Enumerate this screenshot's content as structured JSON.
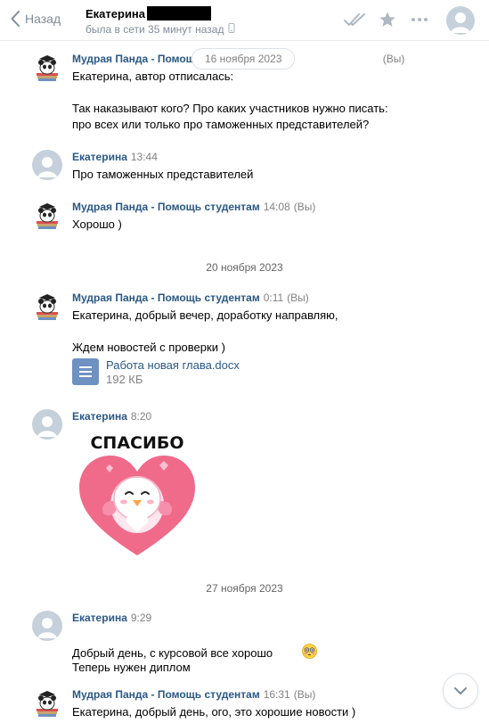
{
  "header": {
    "back_label": "Назад",
    "peer_name": "Екатерина",
    "peer_status": "была в сети 35 минут назад"
  },
  "floating_date": "16 ноября 2023",
  "messages": [
    {
      "author": "Мудрая Панда - Помощь студентам",
      "time": "",
      "suffix": "(Вы)",
      "text": "Екатерина, автор отписалась:\n\nТак наказывают кого? Про каких участников нужно писать:\nпро всех или только про таможенных представителей?"
    },
    {
      "author": "Екатерина",
      "time": "13:44",
      "text": "Про таможенных представителей"
    },
    {
      "author": "Мудрая Панда - Помощь студентам",
      "time": "14:08",
      "suffix": "(Вы)",
      "text": "Хорошо )"
    },
    {
      "author": "Мудрая Панда - Помощь студентам",
      "time": "0:11",
      "suffix": "(Вы)",
      "text": "Екатерина, добрый вечер, доработку направляю,\n\nЖдем новостей с проверки )",
      "file": {
        "name": "Работа новая глава.docx",
        "size": "192 КБ"
      }
    },
    {
      "author": "Екатерина",
      "time": "8:20",
      "sticker": {
        "caption": "СПАСИБО"
      }
    },
    {
      "author": "Екатерина",
      "time": "9:29",
      "text": "Добрый день, с курсовой все хорошо",
      "text2": "Теперь нужен диплом"
    },
    {
      "author": "Мудрая Панда - Помощь студентам",
      "time": "16:31",
      "suffix": "(Вы)",
      "text": "Екатерина, добрый день, ого, это хорошие новости )"
    }
  ],
  "date_separators": [
    "20 ноября 2023",
    "27 ноября 2023"
  ],
  "icons": {
    "back": "chevron-left-icon",
    "read": "double-check-icon",
    "star": "star-icon",
    "more": "more-horizontal-icon",
    "device": "mobile-phone-icon",
    "doc": "document-icon",
    "emoji": "flushed-face-emoji",
    "scroll": "chevron-down-icon"
  },
  "colors": {
    "link": "#2a5885",
    "muted": "#828282",
    "icon": "#818c99",
    "doc_icon": "#6e91c1",
    "sticker_heart": "#f06a8a"
  }
}
